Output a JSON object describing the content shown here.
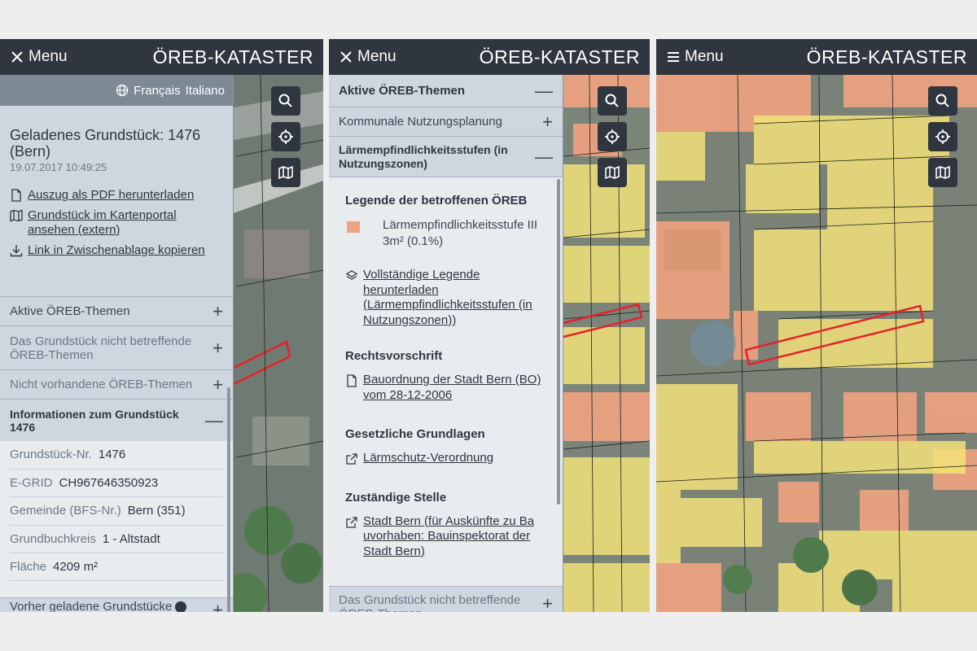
{
  "app": {
    "title": "ÖREB-KATASTER"
  },
  "colors": {
    "topbar": "#2f3640",
    "panel": "#ced6df",
    "selection": "#e8202a",
    "zone_yellow": "#f2e27a",
    "zone_orange": "#f0a37f"
  },
  "screen1": {
    "menu_label": "Menu",
    "menu_icon": "close-icon",
    "languages": [
      "Français",
      "Italiano"
    ],
    "parcel": {
      "title": "Geladenes Grundstück: 1476 (Bern)",
      "date": "19.07.2017 10:49:25"
    },
    "actions": [
      {
        "label": "Auszug als PDF herunterladen",
        "icon": "document-icon"
      },
      {
        "label": "Grundstück im Kartenportal ansehen (extern)",
        "icon": "map-icon"
      },
      {
        "label": "Link in Zwischenablage kopieren",
        "icon": "download-icon"
      }
    ],
    "accordion": [
      {
        "label": "Aktive ÖREB-Themen",
        "toggle": "+"
      },
      {
        "label": "Das Grundstück nicht betreffende ÖREB-Themen",
        "toggle": "+"
      },
      {
        "label": "Nicht vorhandene ÖREB-Themen",
        "toggle": "+"
      },
      {
        "label": "Informationen zum Grundstück 1476",
        "toggle": "—"
      }
    ],
    "info": [
      {
        "key": "Grundstück-Nr.",
        "value": "1476"
      },
      {
        "key": "E-GRID",
        "value": "CH967646350923"
      },
      {
        "key": "Gemeinde (BFS-Nr.)",
        "value": "Bern (351)"
      },
      {
        "key": "Grundbuchkreis",
        "value": "1 - Altstadt"
      },
      {
        "key": "Fläche",
        "value": "4209 m²"
      }
    ],
    "previous": {
      "label": "Vorher geladene Grundstücke",
      "toggle": "+"
    }
  },
  "screen2": {
    "menu_label": "Menu",
    "menu_icon": "close-icon",
    "accordion_top": [
      {
        "label": "Aktive ÖREB-Themen",
        "toggle": "—"
      },
      {
        "label": "Kommunale Nutzungsplanung",
        "toggle": "+"
      },
      {
        "label": "Lärmempfindlichkeitsstufen (in Nutzungszonen)",
        "toggle": "—"
      }
    ],
    "legend_heading": "Legende der betroffenen ÖREB",
    "legend_item": {
      "label": "Lärmempfindlichkeitsstufe III",
      "area": "3m² (0.1%)"
    },
    "full_legend_link": "Vollständige Legende herunterladen (Lärmempfindlichkeitsstufen (in Nutzungszonen))",
    "sections": [
      {
        "heading": "Rechtsvorschrift",
        "link": "Bauordnung der Stadt Bern (BO) vom 28-12-2006",
        "icon": "document-icon"
      },
      {
        "heading": "Gesetzliche Grundlagen",
        "link": "Lärmschutz-Verordnung",
        "icon": "external-link-icon"
      },
      {
        "heading": "Zuständige Stelle",
        "link": "Stadt Bern (für Auskünfte zu Bauvorhaben: Bauinspektorat der Stadt Bern)",
        "icon": "external-link-icon"
      }
    ],
    "accordion_bottom": {
      "label": "Das Grundstück nicht betreffende ÖREB-Themen",
      "toggle": "+"
    }
  },
  "screen3": {
    "menu_label": "Menu",
    "menu_icon": "hamburger-icon"
  },
  "map_tools": [
    "search-icon",
    "locate-icon",
    "map-icon"
  ]
}
